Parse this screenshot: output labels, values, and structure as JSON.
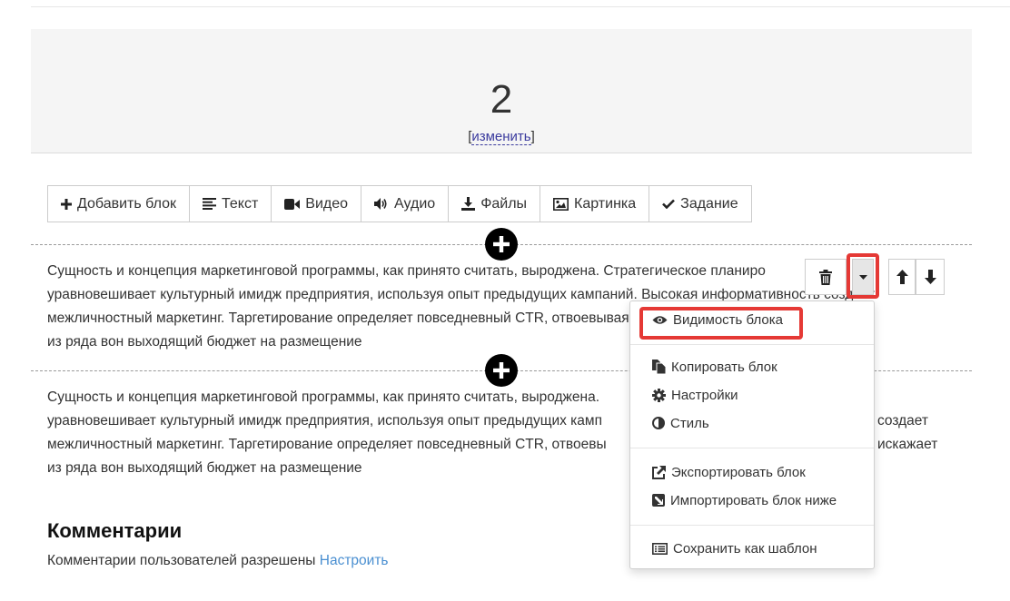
{
  "header": {
    "number": "2",
    "edit_bracket_open": "[",
    "edit_link": "изменить",
    "edit_bracket_close": "]"
  },
  "toolbar": {
    "items": [
      {
        "label": "Добавить блок",
        "icon": "plus-icon"
      },
      {
        "label": "Текст",
        "icon": "text-align-icon"
      },
      {
        "label": "Видео",
        "icon": "video-camera-icon"
      },
      {
        "label": "Аудио",
        "icon": "speaker-icon"
      },
      {
        "label": "Файлы",
        "icon": "download-icon"
      },
      {
        "label": "Картинка",
        "icon": "image-icon"
      },
      {
        "label": "Задание",
        "icon": "check-icon"
      }
    ]
  },
  "blocks": [
    {
      "lines": [
        "Сущность и концепция маркетинговой программы, как принято считать, выроджена. Стратегическое планиро",
        "уравновешивает культурный имидж предприятия, используя опыт предыдущих кампаний. Высокая информативность создает",
        "межличностный маркетинг. Таргетирование определяет повседневный CTR, отвоевывая рыночный сегмент, искажает",
        "из ряда вон выходящий бюджет на размещение"
      ]
    },
    {
      "lines": [
        "Сущность и концепция маркетинговой программы, как принято считать, выроджена.",
        "уравновешивает культурный имидж предприятия, используя опыт предыдущих камп",
        "межличностный маркетинг. Таргетирование определяет повседневный CTR, отвоевы",
        "из ряда вон выходящий бюджет на размещение"
      ],
      "right_fragments": [
        "создает",
        "искажает"
      ]
    }
  ],
  "block_controls": {
    "trash_icon": "trash-icon",
    "caret_icon": "caret-down-icon",
    "up_icon": "arrow-up-icon",
    "down_icon": "arrow-down-icon"
  },
  "dropdown": {
    "items": [
      {
        "label": "Видимость блока",
        "icon": "eye-icon"
      },
      {
        "label": "Копировать блок",
        "icon": "copy-icon"
      },
      {
        "label": "Настройки",
        "icon": "gear-icon"
      },
      {
        "label": "Стиль",
        "icon": "contrast-icon"
      },
      {
        "label": "Экспортировать блок",
        "icon": "external-link-icon"
      },
      {
        "label": "Импортировать блок ниже",
        "icon": "import-icon"
      },
      {
        "label": "Сохранить как шаблон",
        "icon": "template-icon"
      }
    ]
  },
  "comments": {
    "title": "Комментарии",
    "text": "Комментарии пользователей разрешены",
    "link": "Настроить"
  },
  "colors": {
    "highlight": "#e53935",
    "link": "#4a8fd1",
    "edit_link": "#3b3b9e"
  }
}
